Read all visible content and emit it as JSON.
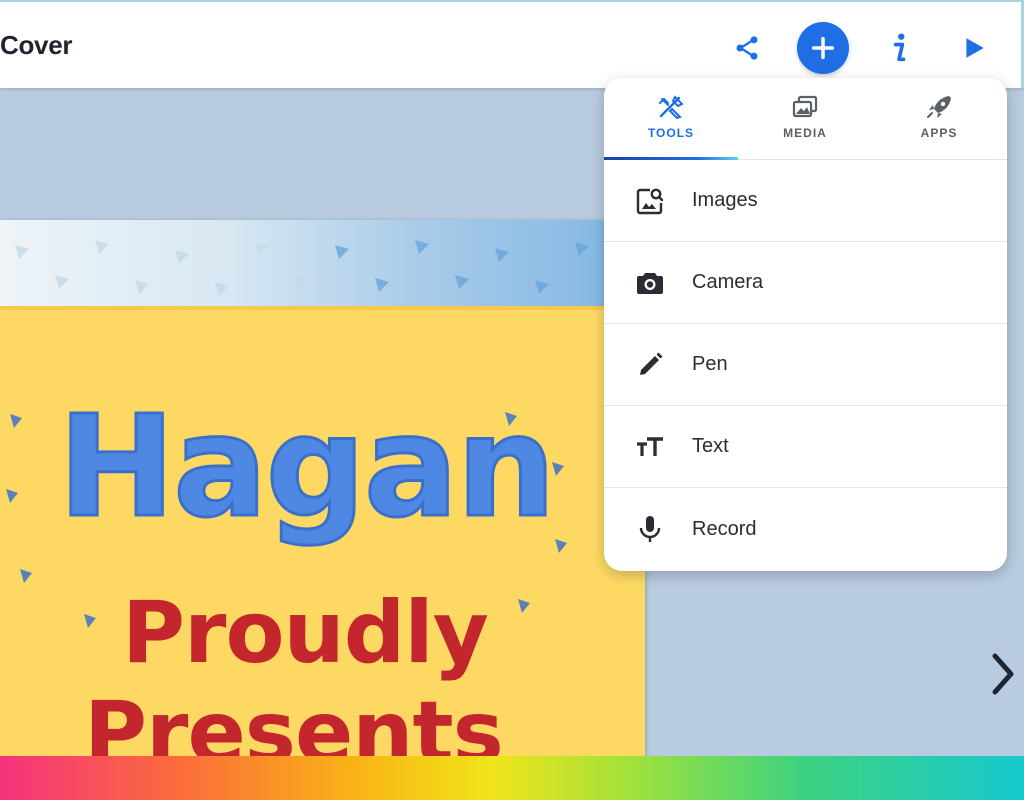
{
  "header": {
    "title": "Cover",
    "icons": [
      "share-icon",
      "add-icon",
      "info-icon",
      "play-icon"
    ]
  },
  "cover": {
    "title": "Hagan",
    "subtitle_line1": "Proudly",
    "subtitle_line2": "Presents"
  },
  "popup": {
    "tabs": [
      {
        "label": "TOOLS",
        "icon": "tools-icon",
        "active": true
      },
      {
        "label": "MEDIA",
        "icon": "media-icon",
        "active": false
      },
      {
        "label": "APPS",
        "icon": "rocket-icon",
        "active": false
      }
    ],
    "items": [
      {
        "label": "Images",
        "icon": "image-search-icon"
      },
      {
        "label": "Camera",
        "icon": "camera-icon"
      },
      {
        "label": "Pen",
        "icon": "pen-icon"
      },
      {
        "label": "Text",
        "icon": "text-size-icon"
      },
      {
        "label": "Record",
        "icon": "microphone-icon"
      }
    ]
  },
  "colors": {
    "accent": "#1f6ee6",
    "background": "#b9cbe0",
    "cover_yellow": "#fdd964",
    "title_blue": "#4f88e3",
    "subtitle_red": "#c3262c"
  }
}
